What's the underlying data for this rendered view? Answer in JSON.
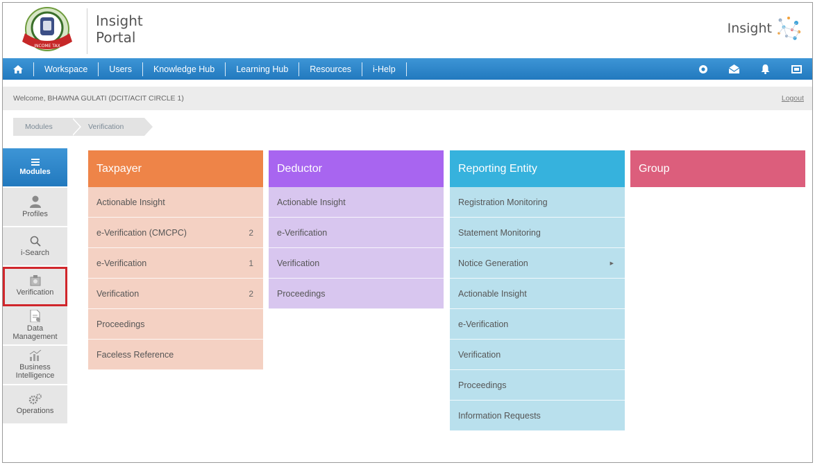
{
  "header": {
    "portal_line1": "Insight",
    "portal_line2": "Portal",
    "logo_text": "Insight"
  },
  "nav": {
    "items": [
      "Workspace",
      "Users",
      "Knowledge Hub",
      "Learning Hub",
      "Resources",
      "i-Help"
    ]
  },
  "welcome": {
    "text": "Welcome, BHAWNA GULATI (DCIT/ACIT CIRCLE 1)",
    "logout": "Logout"
  },
  "breadcrumb": [
    "Modules",
    "Verification"
  ],
  "sidebar": {
    "items": [
      {
        "label": "Modules",
        "icon": "menu-icon"
      },
      {
        "label": "Profiles",
        "icon": "user-icon"
      },
      {
        "label": "i-Search",
        "icon": "search-icon"
      },
      {
        "label": "Verification",
        "icon": "verification-icon"
      },
      {
        "label_1": "Data",
        "label_2": "Management",
        "icon": "data-management-icon"
      },
      {
        "label_1": "Business",
        "label_2": "Intelligence",
        "icon": "business-intelligence-icon"
      },
      {
        "label": "Operations",
        "icon": "gears-icon"
      }
    ]
  },
  "columns": [
    {
      "title": "Taxpayer",
      "header_color": "#ee8448",
      "body_color": "#f4d1c3",
      "items": [
        {
          "label": "Actionable Insight",
          "count": ""
        },
        {
          "label": "e-Verification (CMCPC)",
          "count": "2"
        },
        {
          "label": "e-Verification",
          "count": "1"
        },
        {
          "label": "Verification",
          "count": "2"
        },
        {
          "label": "Proceedings",
          "count": ""
        },
        {
          "label": "Faceless Reference",
          "count": ""
        }
      ]
    },
    {
      "title": "Deductor",
      "header_color": "#a865f0",
      "body_color": "#d8c6ef",
      "items": [
        {
          "label": "Actionable Insight"
        },
        {
          "label": "e-Verification"
        },
        {
          "label": "Verification"
        },
        {
          "label": "Proceedings"
        }
      ]
    },
    {
      "title": "Reporting Entity",
      "header_color": "#36b2dd",
      "body_color": "#b9e0ed",
      "items": [
        {
          "label": "Registration Monitoring"
        },
        {
          "label": "Statement Monitoring"
        },
        {
          "label": "Notice Generation"
        },
        {
          "label": "Actionable Insight"
        },
        {
          "label": "e-Verification"
        },
        {
          "label": "Verification"
        },
        {
          "label": "Proceedings"
        },
        {
          "label": "Information Requests"
        }
      ]
    },
    {
      "title": "Group",
      "header_color": "#dc5e7c",
      "items": []
    }
  ]
}
